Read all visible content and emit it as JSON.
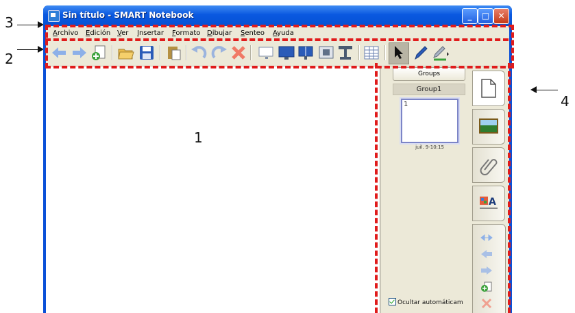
{
  "annotations": {
    "label_1": "1",
    "label_2": "2",
    "label_3": "3",
    "label_4": "4"
  },
  "window": {
    "title": "Sin título - SMART Notebook",
    "min_glyph": "_",
    "max_glyph": "□",
    "close_glyph": "✕"
  },
  "menubar": {
    "items": [
      "Archivo",
      "Edición",
      "Ver",
      "Insertar",
      "Formato",
      "Dibujar",
      "Senteo",
      "Ayuda"
    ]
  },
  "toolbar": {
    "buttons": [
      {
        "icon": "back-arrow-icon",
        "color": "#8db0e8"
      },
      {
        "icon": "forward-arrow-icon",
        "color": "#8db0e8"
      },
      {
        "icon": "add-page-icon",
        "color": "#3aa13a"
      },
      {
        "icon": "open-folder-icon",
        "color": "#e8b94b"
      },
      {
        "icon": "save-icon",
        "color": "#2a5bb8"
      },
      {
        "icon": "paste-icon",
        "color": "#b59042"
      },
      {
        "icon": "undo-icon",
        "color": "#9bb4de"
      },
      {
        "icon": "redo-icon",
        "color": "#9bb4de"
      },
      {
        "icon": "delete-icon",
        "color": "#f07a66"
      },
      {
        "icon": "screen-shade-icon",
        "color": "#7f8fa8"
      },
      {
        "icon": "full-screen-icon",
        "color": "#2a5bb8"
      },
      {
        "icon": "dual-page-icon",
        "color": "#2a5bb8"
      },
      {
        "icon": "capture-icon",
        "color": "#607088"
      },
      {
        "icon": "document-camera-icon",
        "color": "#4a5a70"
      },
      {
        "icon": "insert-table-icon",
        "color": "#6a80b0"
      },
      {
        "icon": "select-pointer-icon",
        "color": "#111111"
      },
      {
        "icon": "pen-icon",
        "color": "#2a5bb8"
      },
      {
        "icon": "creative-pen-icon",
        "color": "#3aa13a"
      }
    ]
  },
  "sidebar": {
    "groups_button": "Groups",
    "group_name": "Group1",
    "page_number": "1",
    "page_time": "juil. 9-10:15",
    "auto_hide_label": "Ocultar automáticam",
    "tabs": [
      "page-sorter-tab",
      "gallery-tab",
      "attachments-tab",
      "properties-tab"
    ]
  },
  "colors": {
    "highlight_dash": "#e01b1b",
    "title_blue": "#0a58e0",
    "chrome_beige": "#ece9d8"
  }
}
